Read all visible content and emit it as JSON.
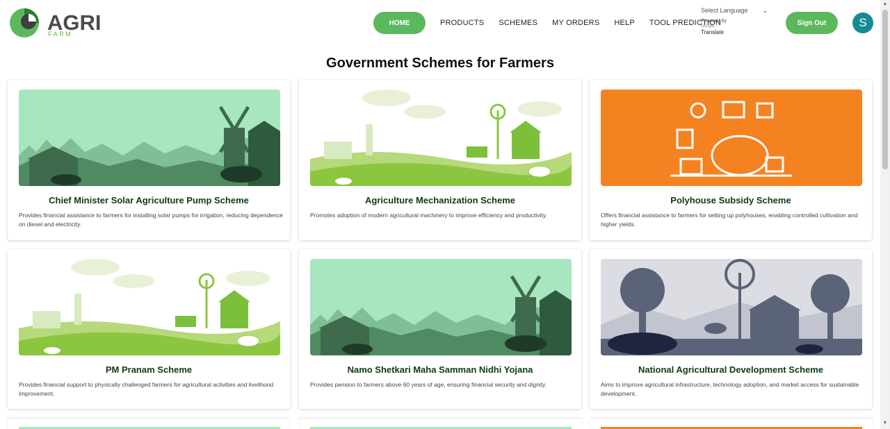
{
  "brand": {
    "name": "AGRI",
    "sub": "FARM"
  },
  "nav": {
    "home": "HOME",
    "products": "PRODUCTS",
    "schemes": "SCHEMES",
    "orders": "MY ORDERS",
    "help": "HELP",
    "tool": "TOOL PREDICTION"
  },
  "language": {
    "select": "Select Language",
    "powered": "Powered by",
    "google": "Google",
    "translate": "Translate"
  },
  "signout": "Sign Out",
  "avatar_letter": "S",
  "page_title": "Government Schemes for Farmers",
  "colors": {
    "accent": "#5cb85c",
    "avatar": "#178a94",
    "title": "#0d3b14"
  },
  "cards": [
    {
      "title": "Chief Minister Solar Agriculture Pump Scheme",
      "desc": "Provides financial assistance to farmers for installing solar pumps for irrigation, reducing dependence on diesel and electricity.",
      "image": "green-farm-silhouette"
    },
    {
      "title": "Agriculture Mechanization Scheme",
      "desc": "Promotes adoption of modern agricultural machinery to improve efficiency and productivity.",
      "image": "light-green-farm-illustration"
    },
    {
      "title": "Polyhouse Subsidy Scheme",
      "desc": "Offers financial assistance to farmers for setting up polyhouses, enabling controlled cultivation and higher yields.",
      "image": "orange-savings-illustration"
    },
    {
      "title": "PM Pranam Scheme",
      "desc": "Provides financial support to physically challenged farmers for agricultural activities and livelihood improvement.",
      "image": "light-green-farm-illustration"
    },
    {
      "title": "Namo Shetkari Maha Samman Nidhi Yojana",
      "desc": "Provides pension to farmers above 60 years of age, ensuring financial security and dignity.",
      "image": "green-farm-silhouette"
    },
    {
      "title": "National Agricultural Development Scheme",
      "desc": "Aims to improve agricultural infrastructure, technology adoption, and market access for sustainable development.",
      "image": "grey-blue-farm-silhouette"
    }
  ]
}
